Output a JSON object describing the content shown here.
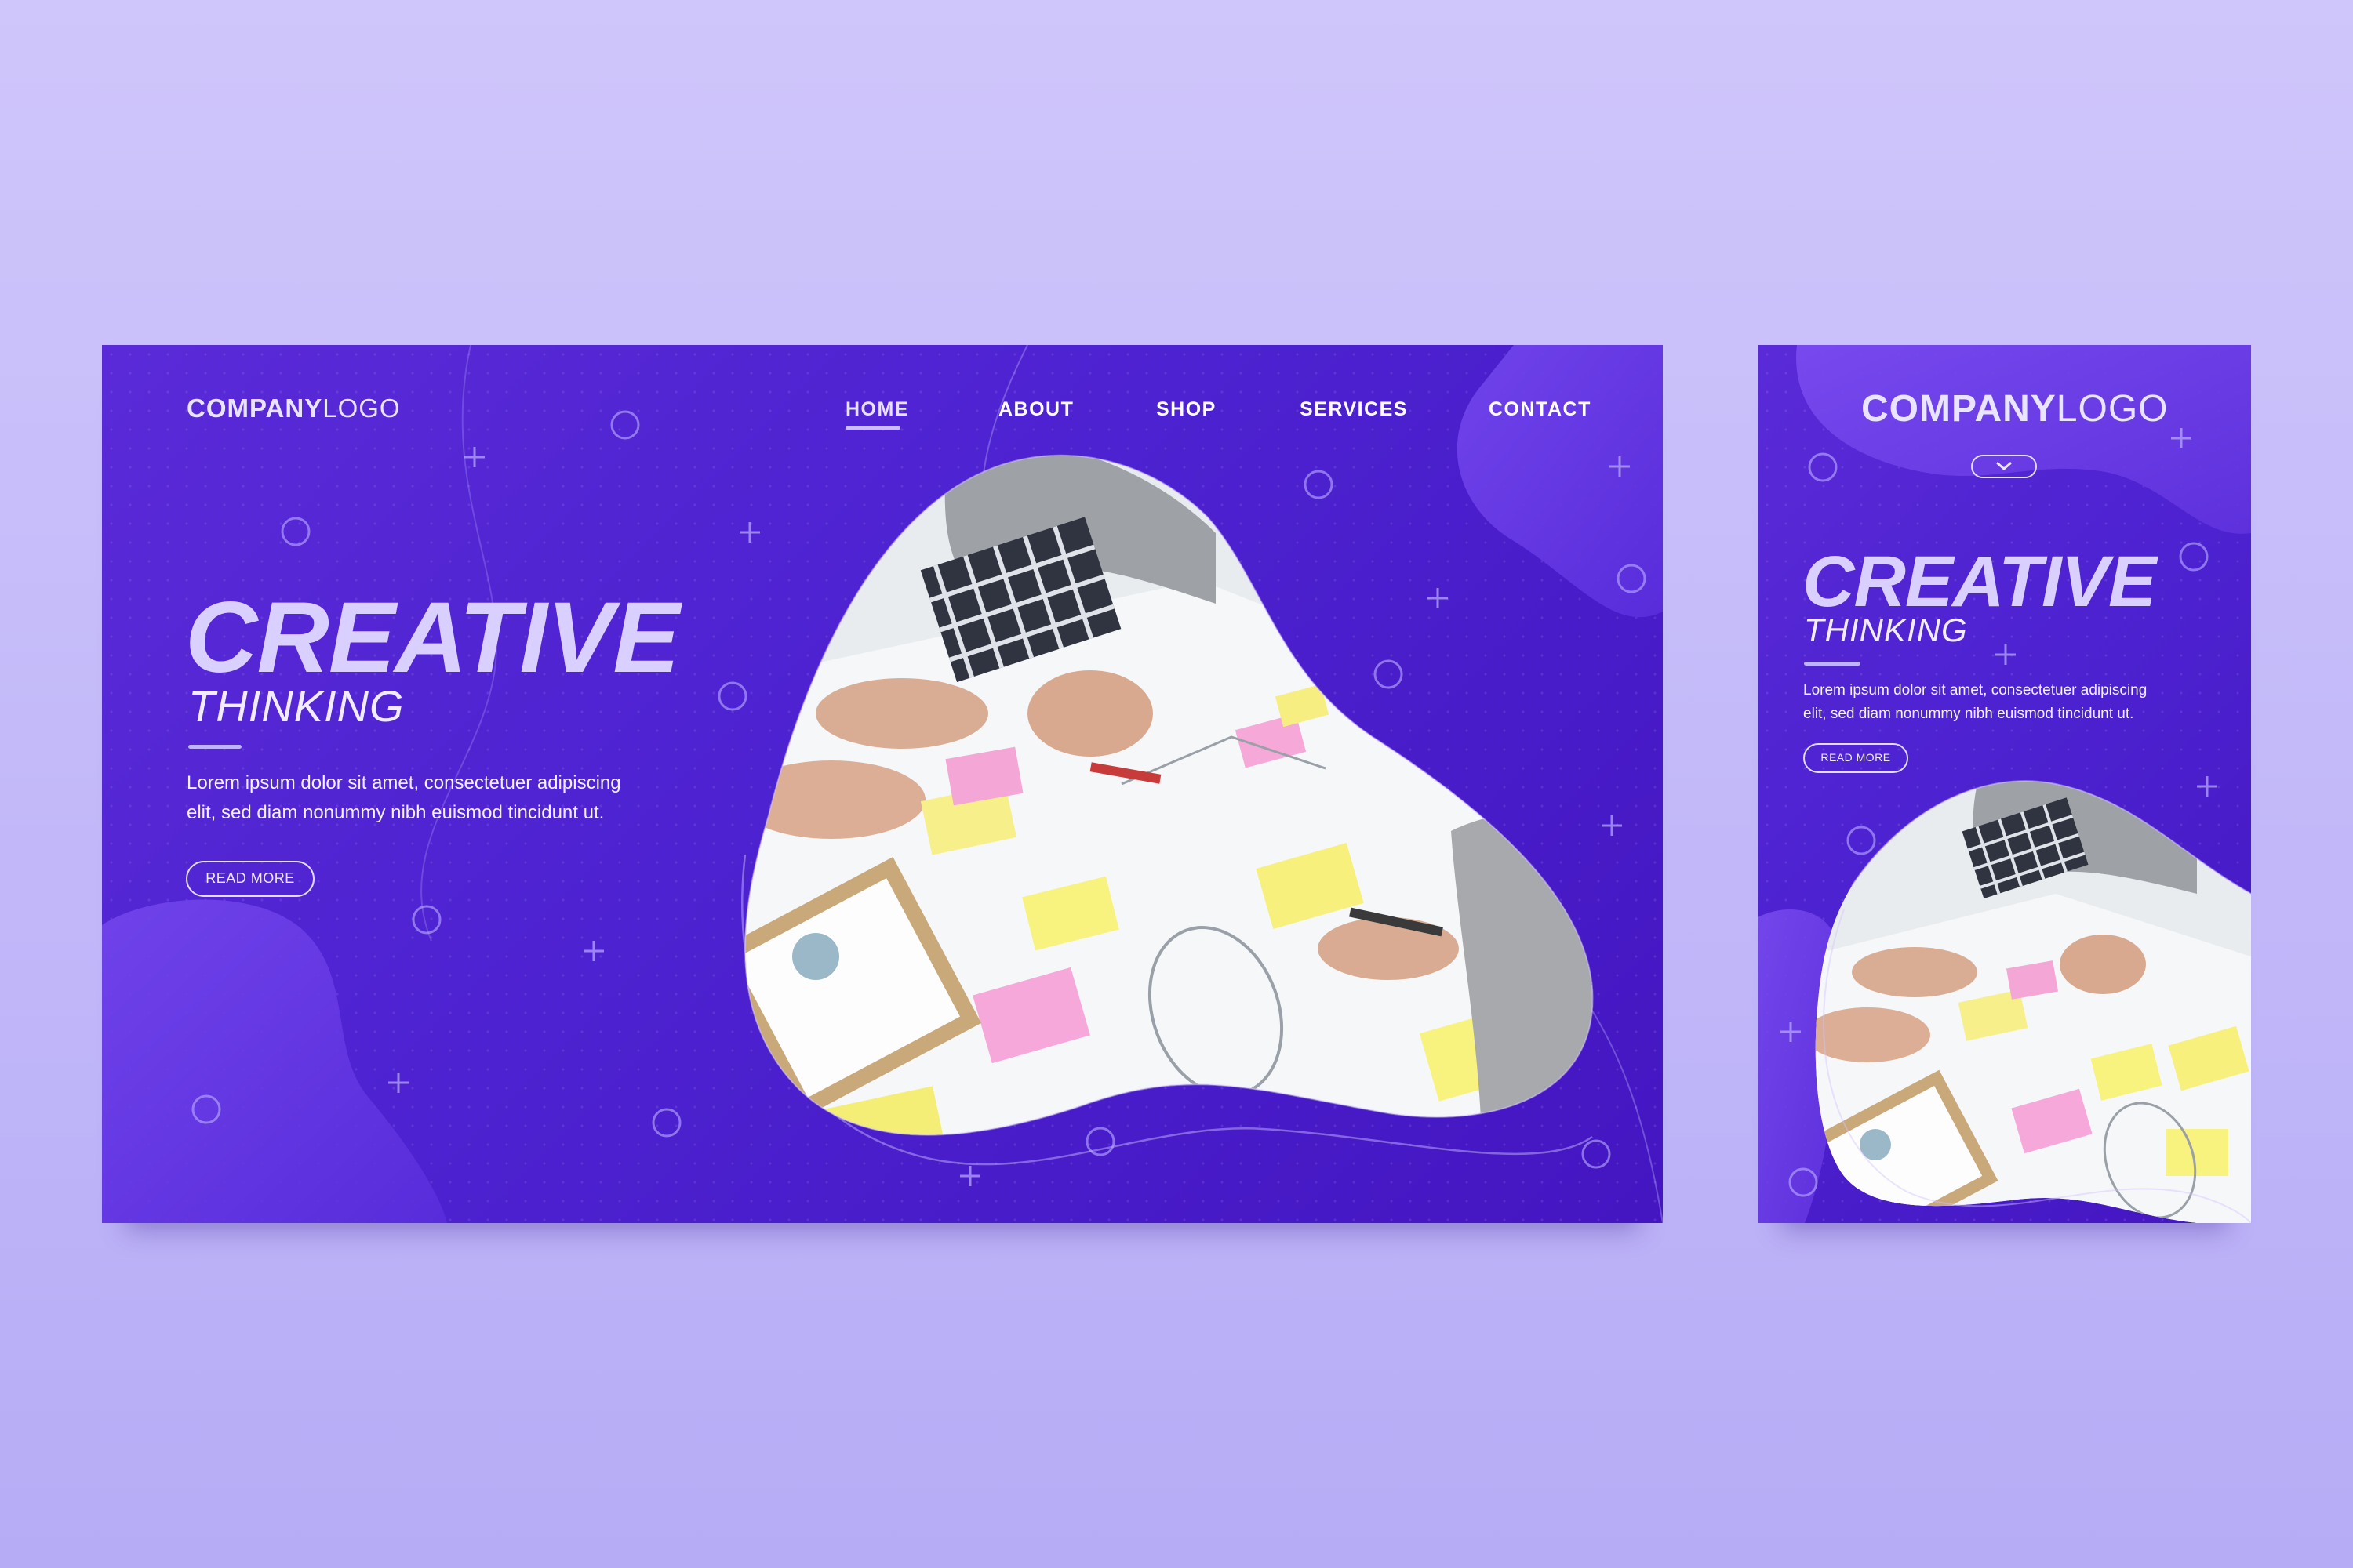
{
  "desktop": {
    "logo": {
      "bold": "COMPANY",
      "light": "LOGO"
    },
    "nav": [
      {
        "label": "HOME",
        "active": true
      },
      {
        "label": "ABOUT",
        "active": false
      },
      {
        "label": "SHOP",
        "active": false
      },
      {
        "label": "SERVICES",
        "active": false
      },
      {
        "label": "CONTACT",
        "active": false
      }
    ],
    "hero": {
      "title": "CREATIVE",
      "subtitle": "THINKING",
      "body_line1": "Lorem ipsum dolor sit amet, consectetuer adipiscing",
      "body_line2": "elit, sed diam nonummy nibh euismod tincidunt ut.",
      "button_label": "READ MORE"
    },
    "image_icon": "brainstorm-photo"
  },
  "mobile": {
    "logo": {
      "bold": "COMPANY",
      "light": "LOGO"
    },
    "menu_icon": "chevron-down-icon",
    "hero": {
      "title": "CREATIVE",
      "subtitle": "THINKING",
      "body_line1": "Lorem ipsum dolor sit amet, consectetuer adipiscing",
      "body_line2": "elit, sed diam nonummy nibh euismod tincidunt ut.",
      "button_label": "READ MORE"
    },
    "image_icon": "brainstorm-photo"
  },
  "colors": {
    "background": "#c8bffa",
    "panel": "#4f24d2",
    "accent": "#bfb2ff",
    "blob": "#6b3be6"
  }
}
